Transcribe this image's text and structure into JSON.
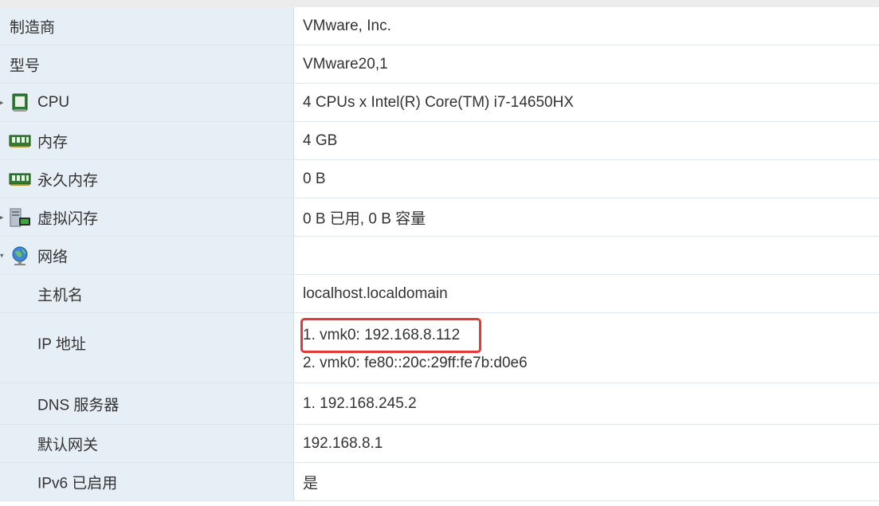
{
  "rows": [
    {
      "label": "制造商",
      "value": "VMware, Inc."
    },
    {
      "label": "型号",
      "value": "VMware20,1"
    },
    {
      "label": "CPU",
      "value": "4 CPUs x Intel(R) Core(TM) i7-14650HX",
      "icon": "cpu-icon"
    },
    {
      "label": "内存",
      "value": "4 GB",
      "icon": "memory-icon"
    },
    {
      "label": "永久内存",
      "value": "0 B",
      "icon": "persistent-memory-icon"
    },
    {
      "label": "虚拟闪存",
      "value": "0 B 已用, 0 B 容量",
      "icon": "virtual-flash-icon"
    },
    {
      "label": "网络",
      "value": "",
      "icon": "network-globe-icon"
    },
    {
      "label": "主机名",
      "value": "localhost.localdomain"
    },
    {
      "label": "IP 地址",
      "values": [
        "1. vmk0: 192.168.8.112",
        "2. vmk0: fe80::20c:29ff:fe7b:d0e6"
      ]
    },
    {
      "label": "DNS 服务器",
      "value": "1. 192.168.245.2"
    },
    {
      "label": "默认网关",
      "value": "192.168.8.1"
    },
    {
      "label": "IPv6 已启用",
      "value": "是"
    }
  ],
  "colors": {
    "label_bg": "#e6eef6",
    "highlight_border": "#e23a3a"
  }
}
